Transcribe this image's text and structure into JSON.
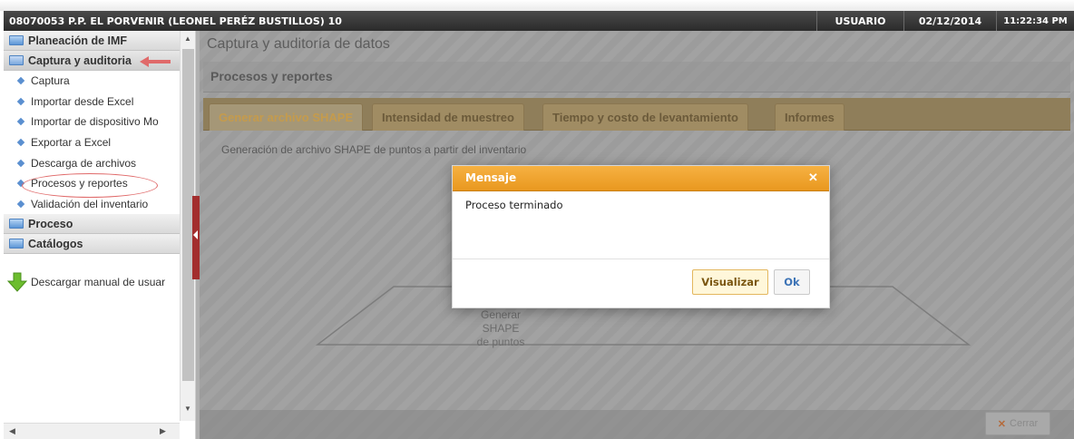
{
  "titlebar": {
    "title": "08070053 P.P. EL PORVENIR (LEONEL PERÉZ BUSTILLOS) 10",
    "user": "USUARIO",
    "date": "02/12/2014",
    "time": "11:22:34 PM"
  },
  "sidebar": {
    "sections": [
      {
        "label": "Planeación de IMF",
        "icon": "folder-icon"
      },
      {
        "label": "Captura y auditoria",
        "icon": "open-folder-icon"
      },
      {
        "label": "Proceso",
        "icon": "folder-icon"
      },
      {
        "label": "Catálogos",
        "icon": "folder-icon"
      }
    ],
    "items": [
      {
        "label": "Captura"
      },
      {
        "label": "Importar desde Excel"
      },
      {
        "label": "Importar de dispositivo Mo"
      },
      {
        "label": "Exportar a Excel"
      },
      {
        "label": "Descarga de archivos"
      },
      {
        "label": "Procesos y reportes"
      },
      {
        "label": "Validación del inventario"
      }
    ],
    "download_label": "Descargar manual de usuar",
    "highlight_color": "#e06a6a"
  },
  "main": {
    "title": "Captura y auditoría de datos",
    "section_title": "Procesos y reportes",
    "tabs": [
      {
        "label": "Generar archivo SHAPE",
        "active": true
      },
      {
        "label": "Intensidad de muestreo"
      },
      {
        "label": "Tiempo y costo de levantamiento"
      },
      {
        "label": "Informes"
      }
    ],
    "tab_description": "Generación de archivo SHAPE de puntos a partir del inventario",
    "shape_label_lines": [
      "Generar",
      "SHAPE",
      "de puntos"
    ],
    "close_label": "Cerrar"
  },
  "dialog": {
    "title": "Mensaje",
    "message": "Proceso terminado",
    "buttons": {
      "visualize": "Visualizar",
      "ok": "Ok"
    },
    "header_color": "#f0a530"
  }
}
